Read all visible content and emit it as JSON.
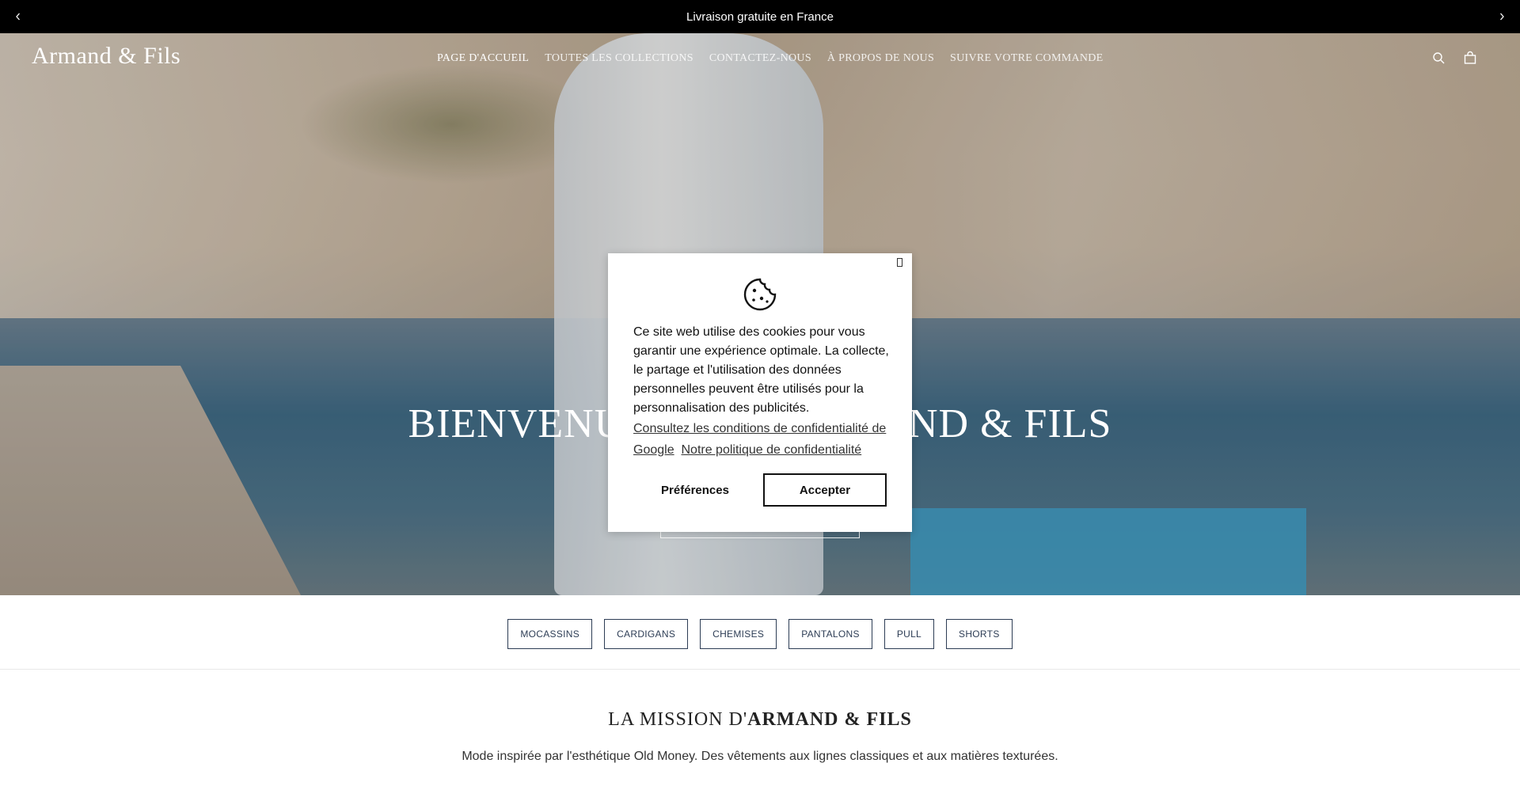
{
  "announcement": {
    "text": "Livraison gratuite en France"
  },
  "header": {
    "logo": "Armand & Fils",
    "nav": [
      "PAGE D'ACCUEIL",
      "TOUTES LES COLLECTIONS",
      "CONTACTEZ-NOUS",
      "À PROPOS DE NOUS",
      "SUIVRE VOTRE COMMANDE"
    ],
    "icons": [
      "search-icon",
      "bag-icon"
    ]
  },
  "hero": {
    "title": "BIENVENUE CHEZ ARMAND & FILS"
  },
  "categories": [
    "MOCASSINS",
    "CARDIGANS",
    "CHEMISES",
    "PANTALONS",
    "PULL",
    "SHORTS"
  ],
  "mission": {
    "title_prefix": "LA MISSION D'",
    "title_brand": "ARMAND & FILS",
    "text": "Mode inspirée par l'esthétique Old Money. Des vêtements aux lignes classiques et aux matières texturées."
  },
  "cookie": {
    "close": "",
    "text": "Ce site web utilise des cookies pour vous garantir une expérience optimale. La collecte, le partage et l'utilisation des données personnelles peuvent être utilisés pour la personnalisation des publicités.",
    "link_google": "Consultez les conditions de confidentialité de Google",
    "link_policy": "Notre politique de confidentialité",
    "preferences": "Préférences",
    "accept": "Accepter"
  }
}
